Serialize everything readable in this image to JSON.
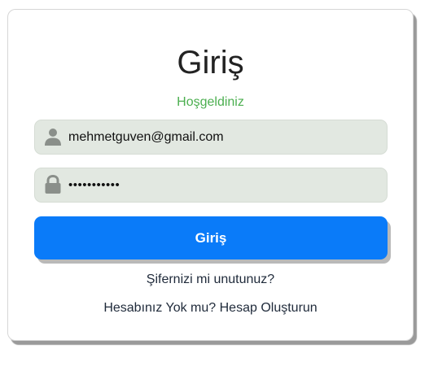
{
  "login": {
    "title": "Giriş",
    "welcome": "Hoşgeldiniz",
    "welcome_color": "#4caf50",
    "email_value": "mehmetguven@gmail.com",
    "password_value": "•••••••••••",
    "submit_label": "Giriş",
    "accent_color": "#0a7bf9",
    "forgot_label": "Şifernizi mi unutunuz?",
    "signup_label": "Hesabınız Yok mu? Hesap Oluşturun",
    "icons": {
      "email": "user-icon",
      "password": "lock-icon"
    }
  }
}
